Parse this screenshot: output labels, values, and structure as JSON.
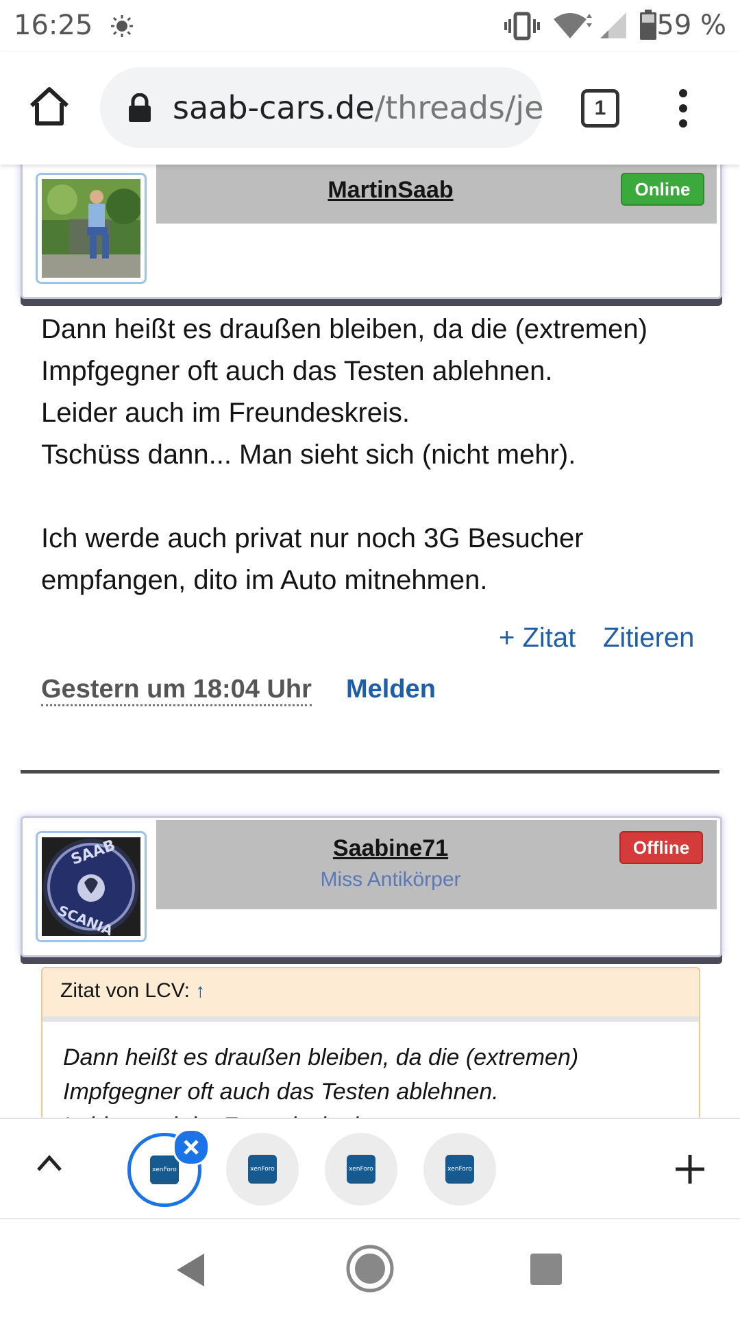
{
  "status_bar": {
    "time": "16:25",
    "battery_percent": "59 %",
    "icons": [
      "brightness-icon",
      "vibrate-icon",
      "wifi-icon",
      "signal-icon",
      "battery-icon"
    ]
  },
  "browser": {
    "url_host": "saab-cars.de",
    "url_path": "/threads/je",
    "tab_count": "1",
    "icons": [
      "home-icon",
      "lock-icon",
      "menu-dots-icon"
    ]
  },
  "posts": [
    {
      "username": "MartinSaab",
      "status": "Online",
      "status_color": "#3ba93b",
      "body": [
        "Dann heißt es draußen bleiben, da die (extremen)",
        "Impfgegner oft auch das Testen ablehnen.",
        "Leider auch im Freundeskreis.",
        "Tschüss dann... Man sieht sich (nicht mehr).",
        "",
        "Ich werde auch privat nur noch 3G Besucher",
        "empfangen, dito im Auto mitnehmen."
      ],
      "actions": {
        "multiquote": "+ Zitat",
        "quote": "Zitieren"
      },
      "date": "Gestern um 18:04 Uhr",
      "report": "Melden"
    },
    {
      "username": "Saabine71",
      "user_title": "Miss Antikörper",
      "status": "Offline",
      "status_color": "#d43c3c",
      "avatar_logo_text": [
        "SAAB",
        "SCANIA"
      ],
      "quote": {
        "label": "Zitat von LCV:",
        "arrow": "↑",
        "lines": [
          "Dann heißt es draußen bleiben, da die (extremen)",
          "Impfgegner oft auch das Testen ablehnen.",
          "Leider auch im Freundeskreis."
        ]
      }
    }
  ],
  "tab_strip": {
    "tabs": [
      {
        "favicon": "xenForo",
        "active": true
      },
      {
        "favicon": "xenForo",
        "active": false
      },
      {
        "favicon": "xenForo",
        "active": false
      },
      {
        "favicon": "xenForo",
        "active": false
      }
    ],
    "icons": [
      "chevron-up-icon",
      "close-icon",
      "plus-icon"
    ]
  },
  "nav_bar": {
    "icons": [
      "back-icon",
      "home-circle-icon",
      "recents-icon"
    ]
  }
}
